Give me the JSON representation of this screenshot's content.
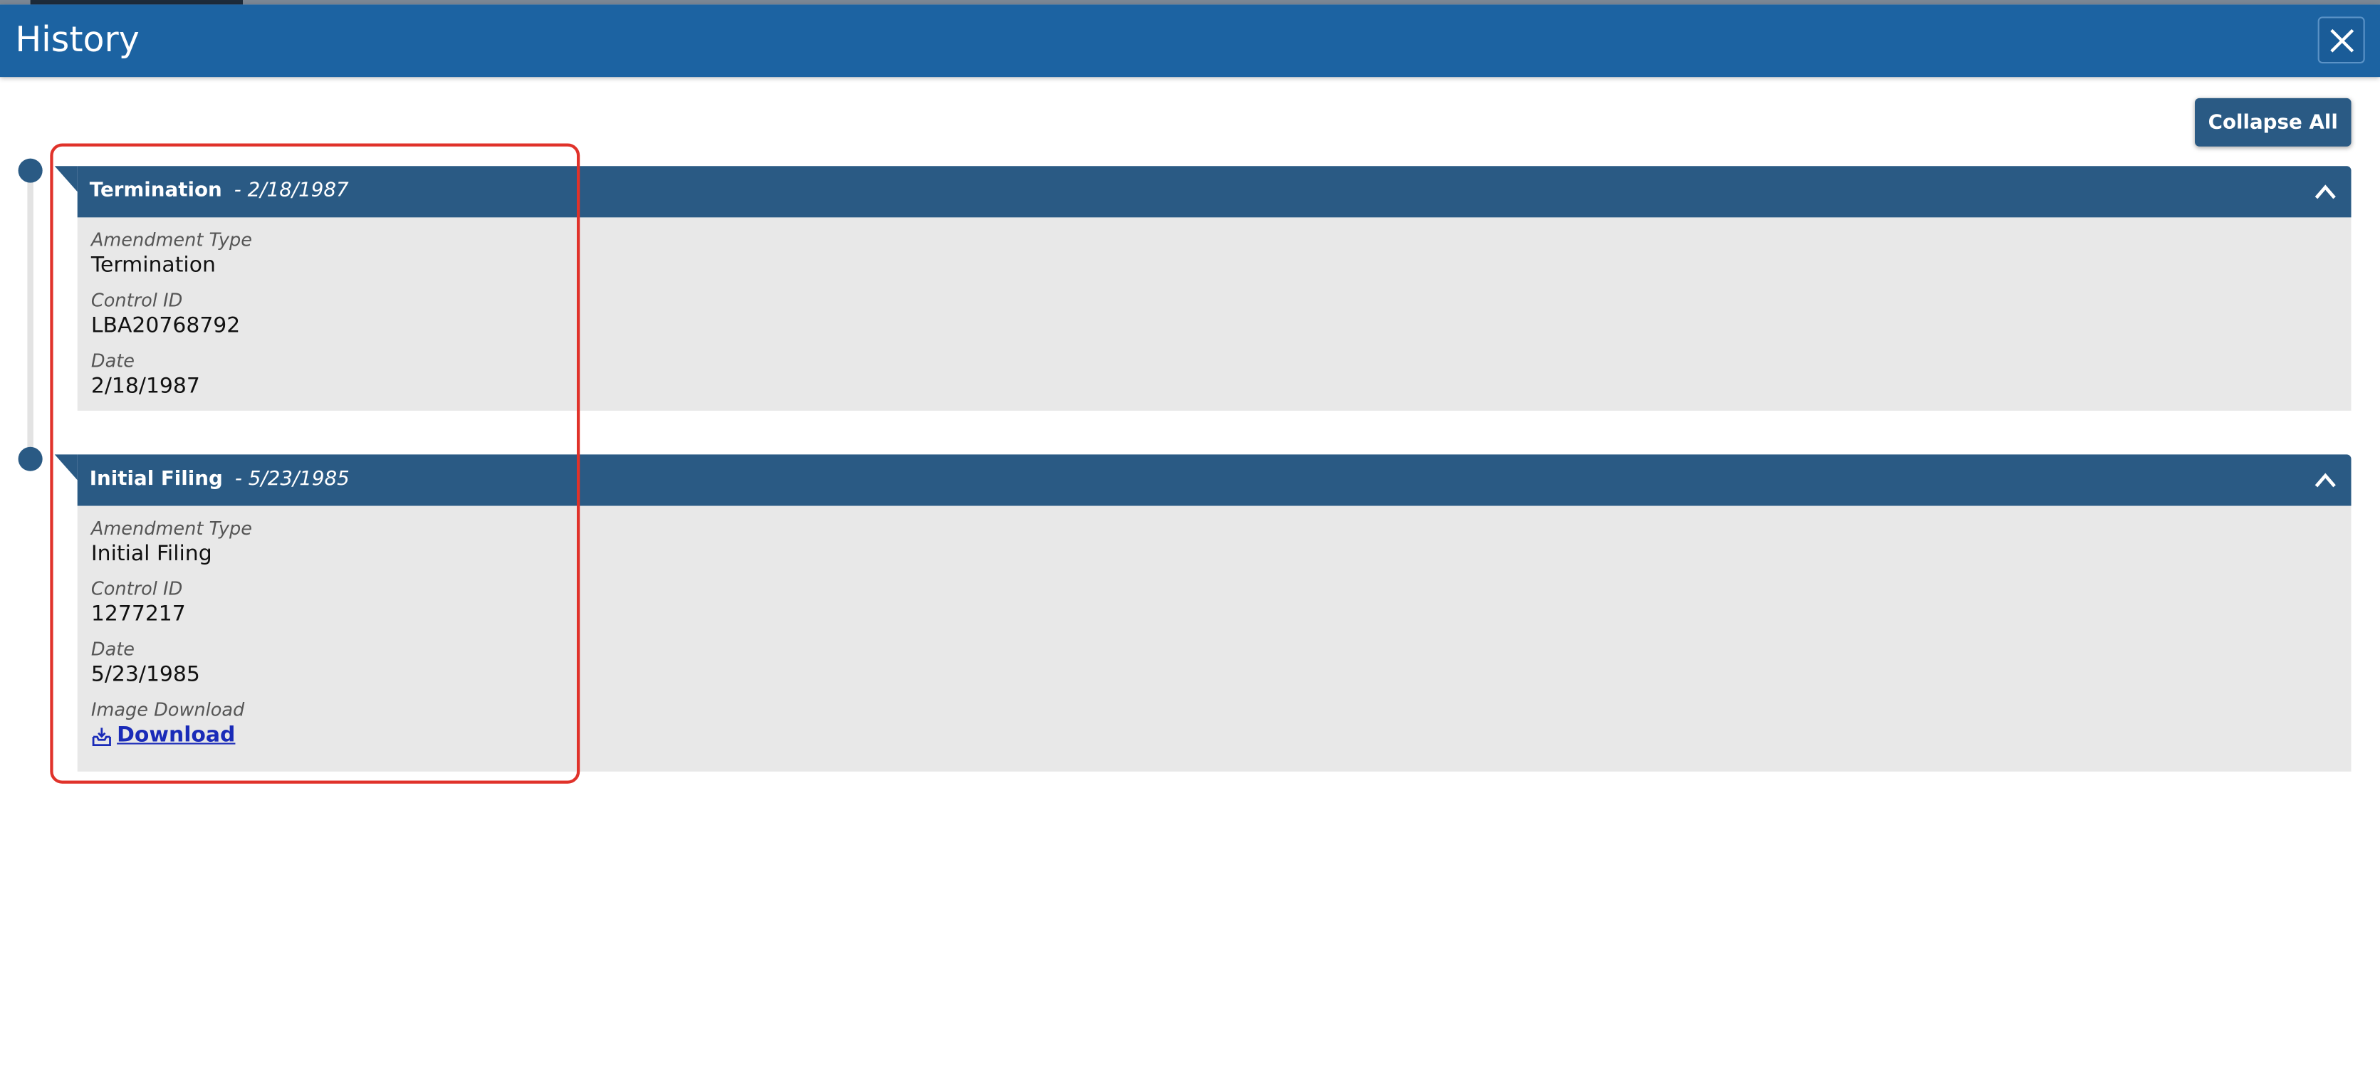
{
  "modal": {
    "title": "History",
    "close_icon": "close-icon"
  },
  "toolbar": {
    "collapse_all_label": "Collapse All"
  },
  "entries": [
    {
      "title": "Termination",
      "date_suffix": "- 2/18/1987",
      "expanded": true,
      "fields": {
        "amendment_type_label": "Amendment Type",
        "amendment_type_value": "Termination",
        "control_id_label": "Control ID",
        "control_id_value": "LBA20768792",
        "date_label": "Date",
        "date_value": "2/18/1987"
      }
    },
    {
      "title": "Initial Filing",
      "date_suffix": "- 5/23/1985",
      "expanded": true,
      "fields": {
        "amendment_type_label": "Amendment Type",
        "amendment_type_value": "Initial Filing",
        "control_id_label": "Control ID",
        "control_id_value": "1277217",
        "date_label": "Date",
        "date_value": "5/23/1985",
        "image_download_label": "Image Download",
        "download_link_label": "Download",
        "download_icon": "download-tray-icon"
      }
    }
  ],
  "colors": {
    "header_blue": "#1c63a2",
    "entry_header": "#2a5a84",
    "entry_body": "#e8e8e8",
    "highlight": "#e0322a",
    "link": "#1a2bb8"
  }
}
